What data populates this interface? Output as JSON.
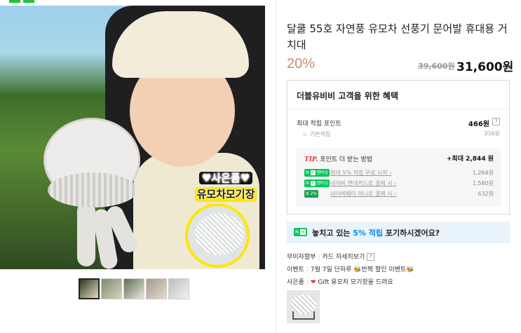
{
  "product": {
    "title": "달쿨 55호 자연풍 유모차 선풍기 문어발 휴대용 거치대",
    "discount": "20%",
    "original_price": "39,600원",
    "sale_price": "31,600원"
  },
  "gallery": {
    "sticker_line1": "♥사은품♥",
    "sticker_line2": "유모차모기장",
    "thumbnails": [
      "thumb-1",
      "thumb-2",
      "thumb-3",
      "thumb-4",
      "thumb-5"
    ],
    "active_thumb": 0
  },
  "benefit": {
    "title": "더블유비비 고객을 위한 혜택",
    "max_points_label": "최대 적립 포인트",
    "max_points_value": "466원",
    "base_label": "기본적립",
    "base_value": "316원",
    "tip_label": "TIP.",
    "tip_text": "포인트 더 받는 방법",
    "tip_max": "+최대 2,844 원",
    "tips": [
      {
        "badge": "멤버십",
        "text": "최대 5% 적립  무료 시작 ›",
        "value": "1,264원"
      },
      {
        "badge": "멤버십",
        "text": "네이버 현대카드로 결제 시 ›",
        "value": "1,580원"
      },
      {
        "badge": "2%",
        "text": "네이버페이 머니로 결제 시 ›",
        "value": "632원"
      }
    ]
  },
  "missed": {
    "badge": "N+",
    "text_prefix": "놓치고 있는 ",
    "text_accent": "5% 적립",
    "text_suffix": " 포기하시겠어요?"
  },
  "meta": {
    "installment_label": "무이자할부",
    "installment_link": "카드 자세히보기",
    "event_label": "이벤트",
    "event_text": "7월 7일 단하루 🐝반짝 할인 이벤트🐝",
    "gift_label": "사은품",
    "gift_text": "Gift 유모차 모기장을 드려요"
  },
  "colors": {
    "discount": "#c98b6e",
    "naver_green": "#03c75a",
    "tip_red": "#e4383a",
    "accent_blue": "#0a8be8"
  }
}
